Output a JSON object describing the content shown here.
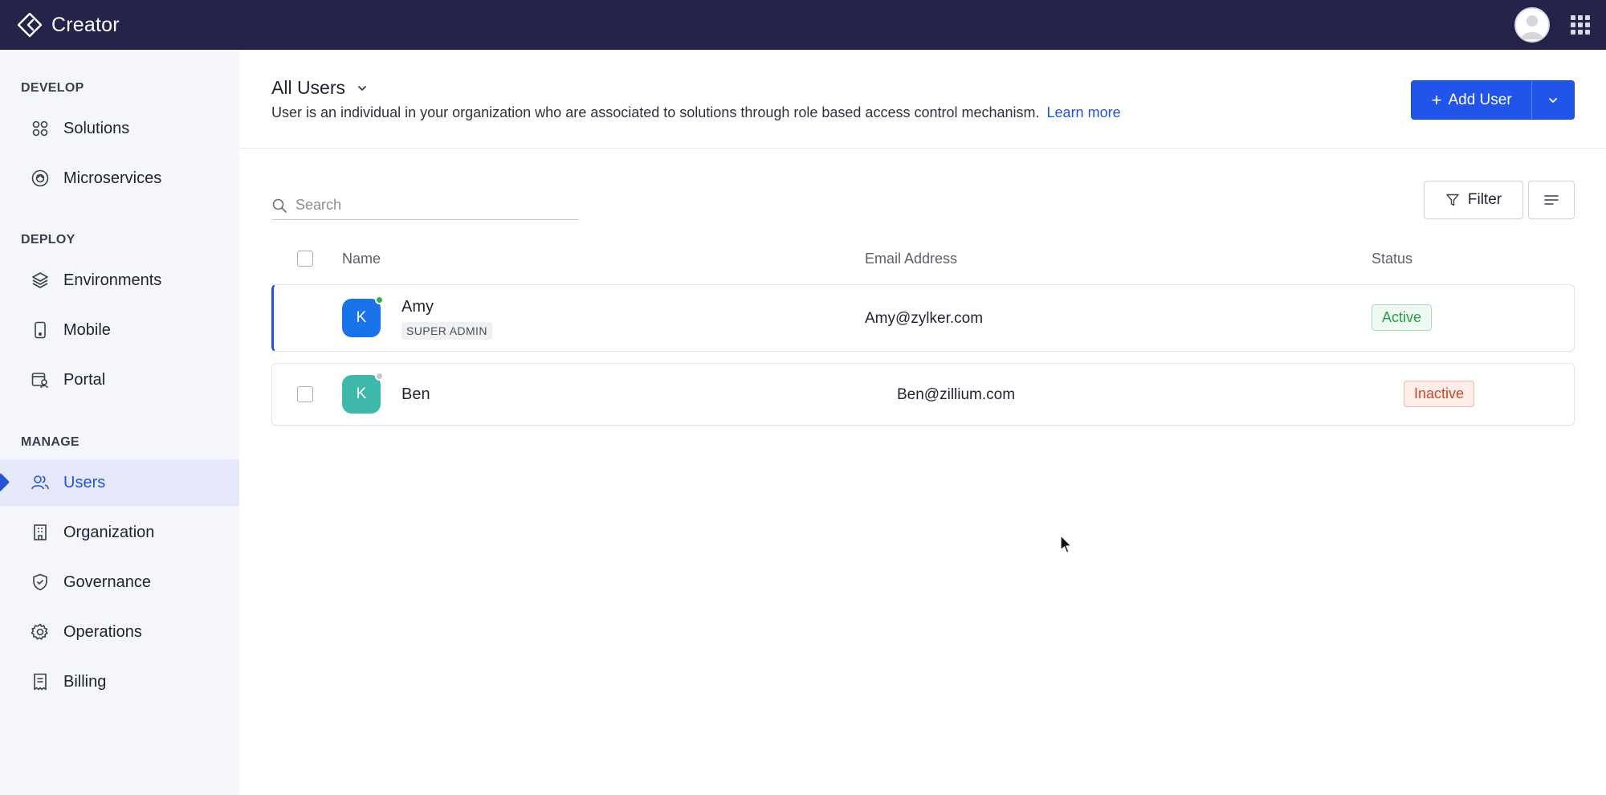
{
  "app": {
    "name": "Creator"
  },
  "sidebar": {
    "sections": [
      {
        "title": "DEVELOP",
        "items": [
          {
            "label": "Solutions",
            "icon": "grid-circles-icon"
          },
          {
            "label": "Microservices",
            "icon": "microservice-icon"
          }
        ]
      },
      {
        "title": "DEPLOY",
        "items": [
          {
            "label": "Environments",
            "icon": "layers-icon"
          },
          {
            "label": "Mobile",
            "icon": "mobile-icon"
          },
          {
            "label": "Portal",
            "icon": "portal-icon"
          }
        ]
      },
      {
        "title": "MANAGE",
        "items": [
          {
            "label": "Users",
            "icon": "users-icon",
            "active": true
          },
          {
            "label": "Organization",
            "icon": "building-icon"
          },
          {
            "label": "Governance",
            "icon": "shield-icon"
          },
          {
            "label": "Operations",
            "icon": "gear-icon"
          },
          {
            "label": "Billing",
            "icon": "receipt-icon"
          }
        ]
      }
    ]
  },
  "header": {
    "title": "All Users",
    "description": "User is an individual in your organization who are associated to solutions through role based access control mechanism.",
    "learn_more": "Learn more",
    "add_user_label": "Add User"
  },
  "toolbar": {
    "search_placeholder": "Search",
    "filter_label": "Filter"
  },
  "table": {
    "columns": [
      "Name",
      "Email Address",
      "Status"
    ],
    "rows": [
      {
        "initial": "K",
        "name": "Amy",
        "role": "SUPER ADMIN",
        "email": "Amy@zylker.com",
        "status": "Active",
        "online": true,
        "avatar_color": "#1a73e8"
      },
      {
        "initial": "K",
        "name": "Ben",
        "role": "",
        "email": "Ben@zillium.com",
        "status": "Inactive",
        "online": false,
        "avatar_color": "#3fb8ac"
      }
    ]
  },
  "colors": {
    "topbar": "#24244a",
    "accent": "#2154d6",
    "active_status": "#2a9a4a",
    "inactive_status": "#d2452a"
  }
}
